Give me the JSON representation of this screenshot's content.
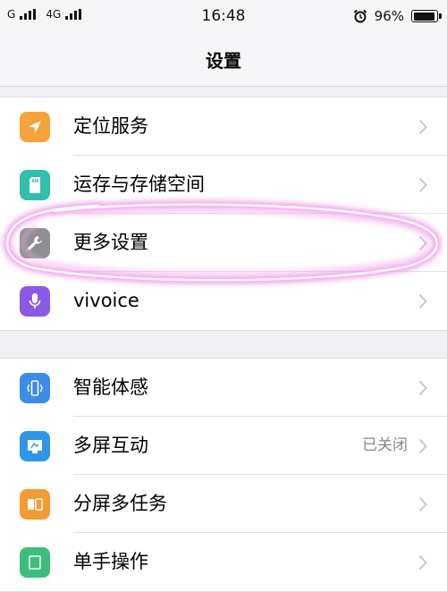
{
  "status_bar": {
    "carrier1": "G",
    "carrier2": "4G",
    "time": "16:48",
    "battery": "96%"
  },
  "nav": {
    "title": "设置"
  },
  "group1": [
    {
      "label": "定位服务",
      "icon": "location-arrow-icon",
      "color": "#f7a23b"
    },
    {
      "label": "运存与存储空间",
      "icon": "sd-card-icon",
      "color": "#2fbfab"
    },
    {
      "label": "更多设置",
      "icon": "wrench-icon",
      "color": "#8e8e93"
    },
    {
      "label": "vivoice",
      "icon": "microphone-icon",
      "color": "#8a5ae6"
    }
  ],
  "group2": [
    {
      "label": "智能体感",
      "icon": "phone-shake-icon",
      "color": "#3c8de8"
    },
    {
      "label": "多屏互动",
      "icon": "screen-cast-icon",
      "color": "#2e96e8",
      "value": "已关闭"
    },
    {
      "label": "分屏多任务",
      "icon": "split-screen-icon",
      "color": "#f59a34"
    },
    {
      "label": "单手操作",
      "icon": "one-hand-icon",
      "color": "#3cbf7a"
    }
  ]
}
